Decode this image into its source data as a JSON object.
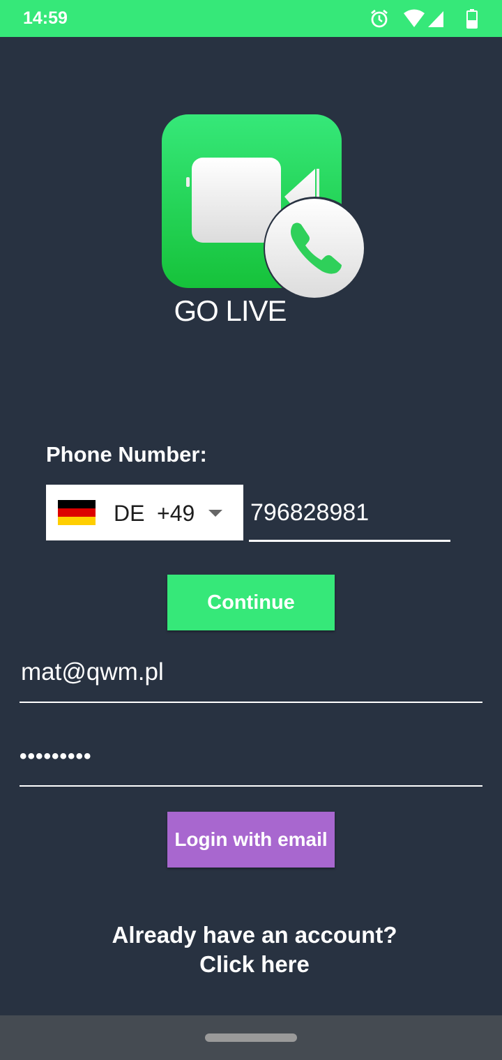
{
  "status_bar": {
    "time": "14:59",
    "icons": [
      "alarm-icon",
      "wifi-icon",
      "signal-icon",
      "battery-icon"
    ],
    "background": "#36e879"
  },
  "app": {
    "title": "GO LIVE",
    "logo_icon": "video-call-icon",
    "brand_color": "#36e879"
  },
  "phone": {
    "label": "Phone Number:",
    "country_code": "DE",
    "dial_code": "+49",
    "flag_icon": "germany-flag-icon",
    "number": "796828981"
  },
  "continue_button": {
    "label": "Continue",
    "color": "#36e879"
  },
  "email": {
    "value": "mat@qwm.pl"
  },
  "password": {
    "value": "•••••••••"
  },
  "login_button": {
    "label": "Login with email",
    "color": "#a867cf"
  },
  "account": {
    "line1": "Already have an account?",
    "line2": "Click here"
  },
  "colors": {
    "background": "#283241",
    "nav_bar": "#454b52"
  }
}
